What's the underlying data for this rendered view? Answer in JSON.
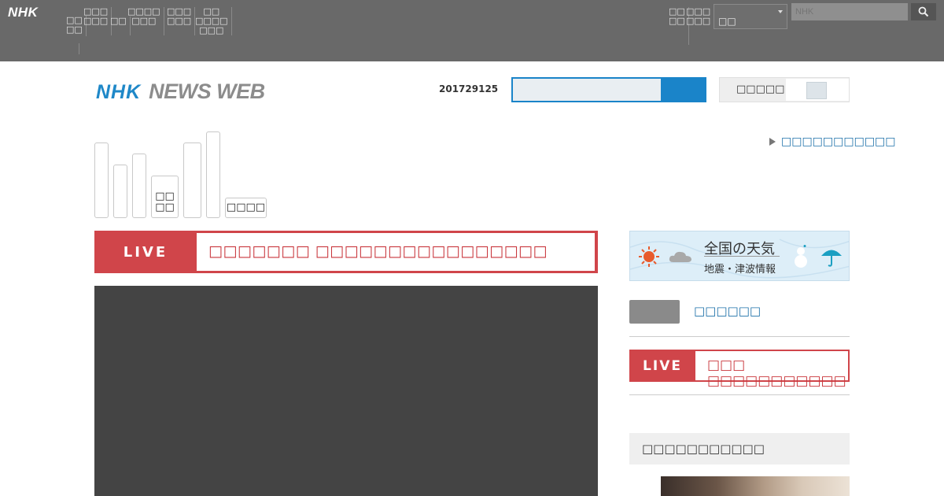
{
  "global_bar": {
    "logo": "NHK",
    "nav": [
      "□□\n□□",
      "□□□\n□□□",
      "□□",
      "□□□□\n□□□",
      "□□□\n□□□",
      "□□\n□□□□\n□□□",
      "□□\n□□",
      "□□□\n□□□"
    ],
    "region": "□□",
    "search_placeholder": "NHK"
  },
  "header": {
    "logo_nhk": "NHK",
    "logo_news_web": "NEWS WEB",
    "date": "201729125",
    "toggle_label": "□□□□□"
  },
  "categories": [
    "□□\n□□",
    "□□□□"
  ],
  "more_link": "□□□□□□□□□□□",
  "main": {
    "live_tag": "LIVE",
    "live_text": "□□□□□□□ □□□□□□□□□□□□□□□□"
  },
  "side": {
    "weather_title": "全国の天気",
    "weather_sub": "地震・津波情報",
    "row1_title": "□□□□□□",
    "live_tag": "LIVE",
    "live_text": "□□□ □□□□□□□□□□□",
    "section_title": "□□□□□□□□□□□"
  },
  "colors": {
    "accent_blue": "#1a84c9",
    "live_red": "#d0454a",
    "topbar": "#696969"
  }
}
